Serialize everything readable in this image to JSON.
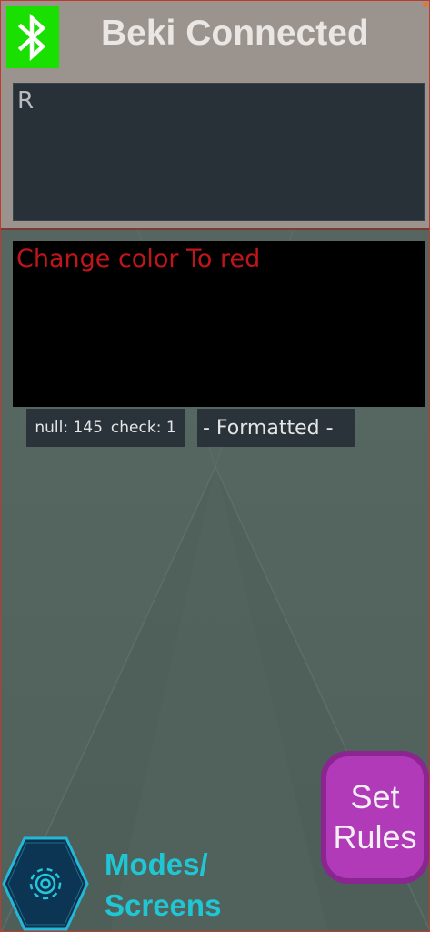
{
  "header": {
    "title": "Beki Connected",
    "bluetooth_icon": "bluetooth-icon",
    "bluetooth_color": "#19e000"
  },
  "received": {
    "text": "R"
  },
  "command": {
    "text": "Change color To red",
    "text_color": "#c0151c"
  },
  "stats": {
    "null_text": "null: 145",
    "check_text": "check: 1"
  },
  "format_button": {
    "label": "- Formatted -"
  },
  "set_rules_button": {
    "label": "Set\nRules",
    "color": "#b03ab8"
  },
  "modes_button": {
    "label": "Modes/\nScreens",
    "icon": "gear-icon",
    "color": "#1fc7d4"
  }
}
